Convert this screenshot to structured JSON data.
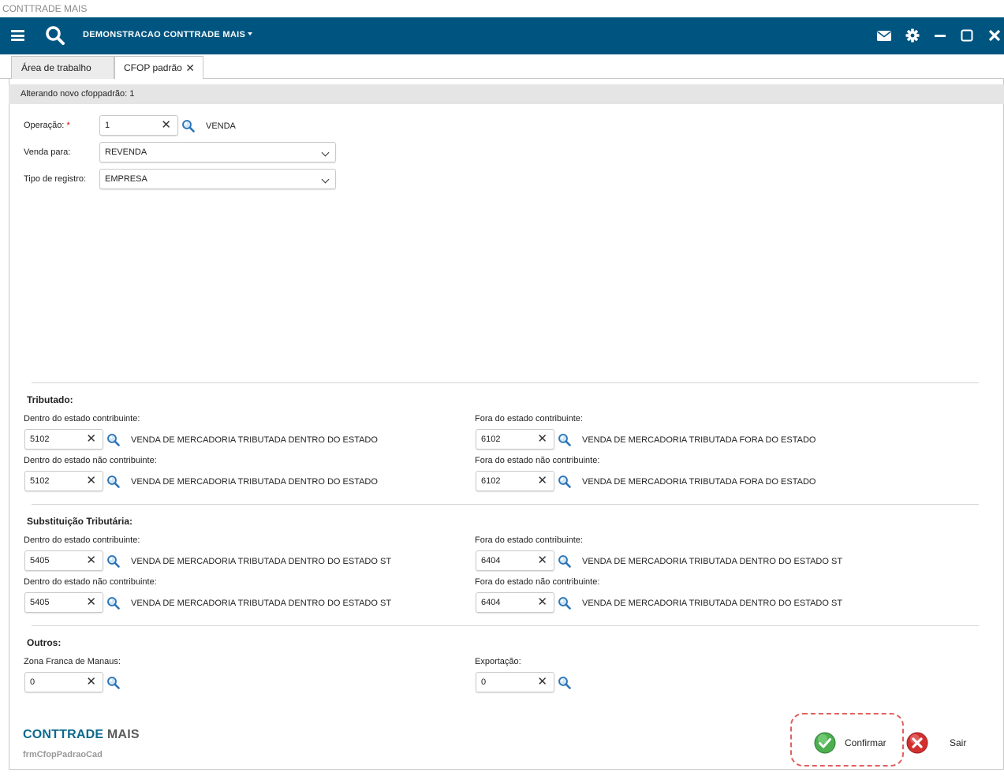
{
  "window": {
    "title": "CONTTRADE MAIS"
  },
  "topbar": {
    "company": "DEMONSTRACAO CONTTRADE MAIS"
  },
  "tabs": [
    {
      "label": "Área de trabalho"
    },
    {
      "label": "CFOP padrão"
    }
  ],
  "form": {
    "header": "Alterando novo cfoppadrão: 1",
    "operacao": {
      "label": "Operação:",
      "required_mark": "*",
      "value": "1",
      "desc": "VENDA"
    },
    "venda_para": {
      "label": "Venda para:",
      "value": "REVENDA"
    },
    "tipo_registro": {
      "label": "Tipo de registro:",
      "value": "EMPRESA"
    }
  },
  "tributado": {
    "title": "Tributado:",
    "dentro_contrib": {
      "label": "Dentro do estado contribuinte:",
      "value": "5102",
      "desc": "VENDA DE MERCADORIA TRIBUTADA DENTRO DO ESTADO"
    },
    "fora_contrib": {
      "label": "Fora do estado contribuinte:",
      "value": "6102",
      "desc": "VENDA DE MERCADORIA TRIBUTADA FORA DO ESTADO"
    },
    "dentro_nao_contrib": {
      "label": "Dentro do estado não contribuinte:",
      "value": "5102",
      "desc": "VENDA DE MERCADORIA TRIBUTADA DENTRO DO ESTADO"
    },
    "fora_nao_contrib": {
      "label": "Fora do estado não contribuinte:",
      "value": "6102",
      "desc": "VENDA DE MERCADORIA TRIBUTADA FORA DO ESTADO"
    }
  },
  "st": {
    "title": "Substituição Tributária:",
    "dentro_contrib": {
      "label": "Dentro do estado contribuinte:",
      "value": "5405",
      "desc": "VENDA DE MERCADORIA TRIBUTADA DENTRO DO ESTADO ST"
    },
    "fora_contrib": {
      "label": "Fora do estado contribuinte:",
      "value": "6404",
      "desc": "VENDA DE MERCADORIA TRIBUTADA DENTRO DO ESTADO ST"
    },
    "dentro_nao_contrib": {
      "label": "Dentro do estado não contribuinte:",
      "value": "5405",
      "desc": "VENDA DE MERCADORIA TRIBUTADA DENTRO DO ESTADO ST"
    },
    "fora_nao_contrib": {
      "label": "Fora do estado não contribuinte:",
      "value": "6404",
      "desc": "VENDA DE MERCADORIA TRIBUTADA DENTRO DO ESTADO ST"
    }
  },
  "outros": {
    "title": "Outros:",
    "zona_franca": {
      "label": "Zona Franca de Manaus:",
      "value": "0"
    },
    "exportacao": {
      "label": "Exportação:",
      "value": "0"
    }
  },
  "footer": {
    "brand_main": "CONTTRADE",
    "brand_suffix": "MAIS",
    "form_name": "frmCfopPadraoCad",
    "confirm_label": "Confirmar",
    "exit_label": "Sair"
  },
  "colors": {
    "topbar": "#005580",
    "brand": "#0d6a8c",
    "highlight": "#e06060",
    "confirm": "#4caf50",
    "exit": "#d32f2f"
  }
}
